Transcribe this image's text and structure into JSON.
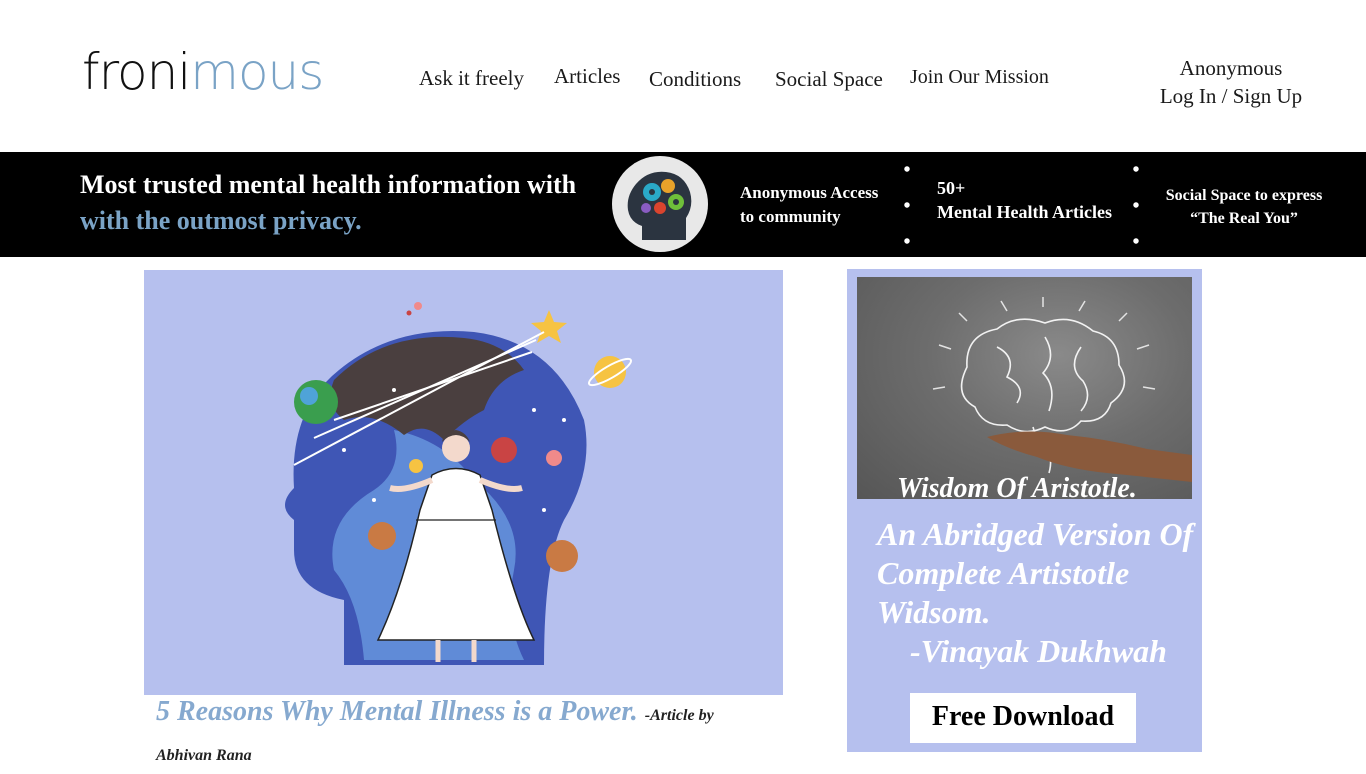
{
  "header": {
    "logo": {
      "part1": "froni",
      "part2": "mous"
    },
    "nav": [
      "Ask it freely",
      "Articles",
      "Conditions",
      "Social Space",
      "Join Our Mission"
    ],
    "auth": {
      "user": "Anonymous",
      "login": "Log In / Sign Up"
    }
  },
  "banner": {
    "tagline_line1": "Most trusted mental health information with",
    "tagline_line2": "with the outmost privacy.",
    "features": [
      {
        "line1": "Anonymous Access",
        "line2": "to community"
      },
      {
        "line1": "50+",
        "line2": "Mental Health Articles"
      },
      {
        "line1": "Social Space to express",
        "line2": "“The Real You”"
      }
    ]
  },
  "article": {
    "title": "5 Reasons Why Mental Illness is a Power.",
    "byline": "-Article by Abhivan Rana"
  },
  "ad": {
    "photo_caption": "Wisdom Of Aristotle.",
    "text": "An Abridged Version Of Complete Artistotle Widsom.",
    "author": "-Vinayak Dukhwah",
    "button": "Free Download"
  },
  "colors": {
    "accent": "#7aa3c6",
    "banner_bg": "#000000",
    "card_bg": "#b6c0ee"
  }
}
